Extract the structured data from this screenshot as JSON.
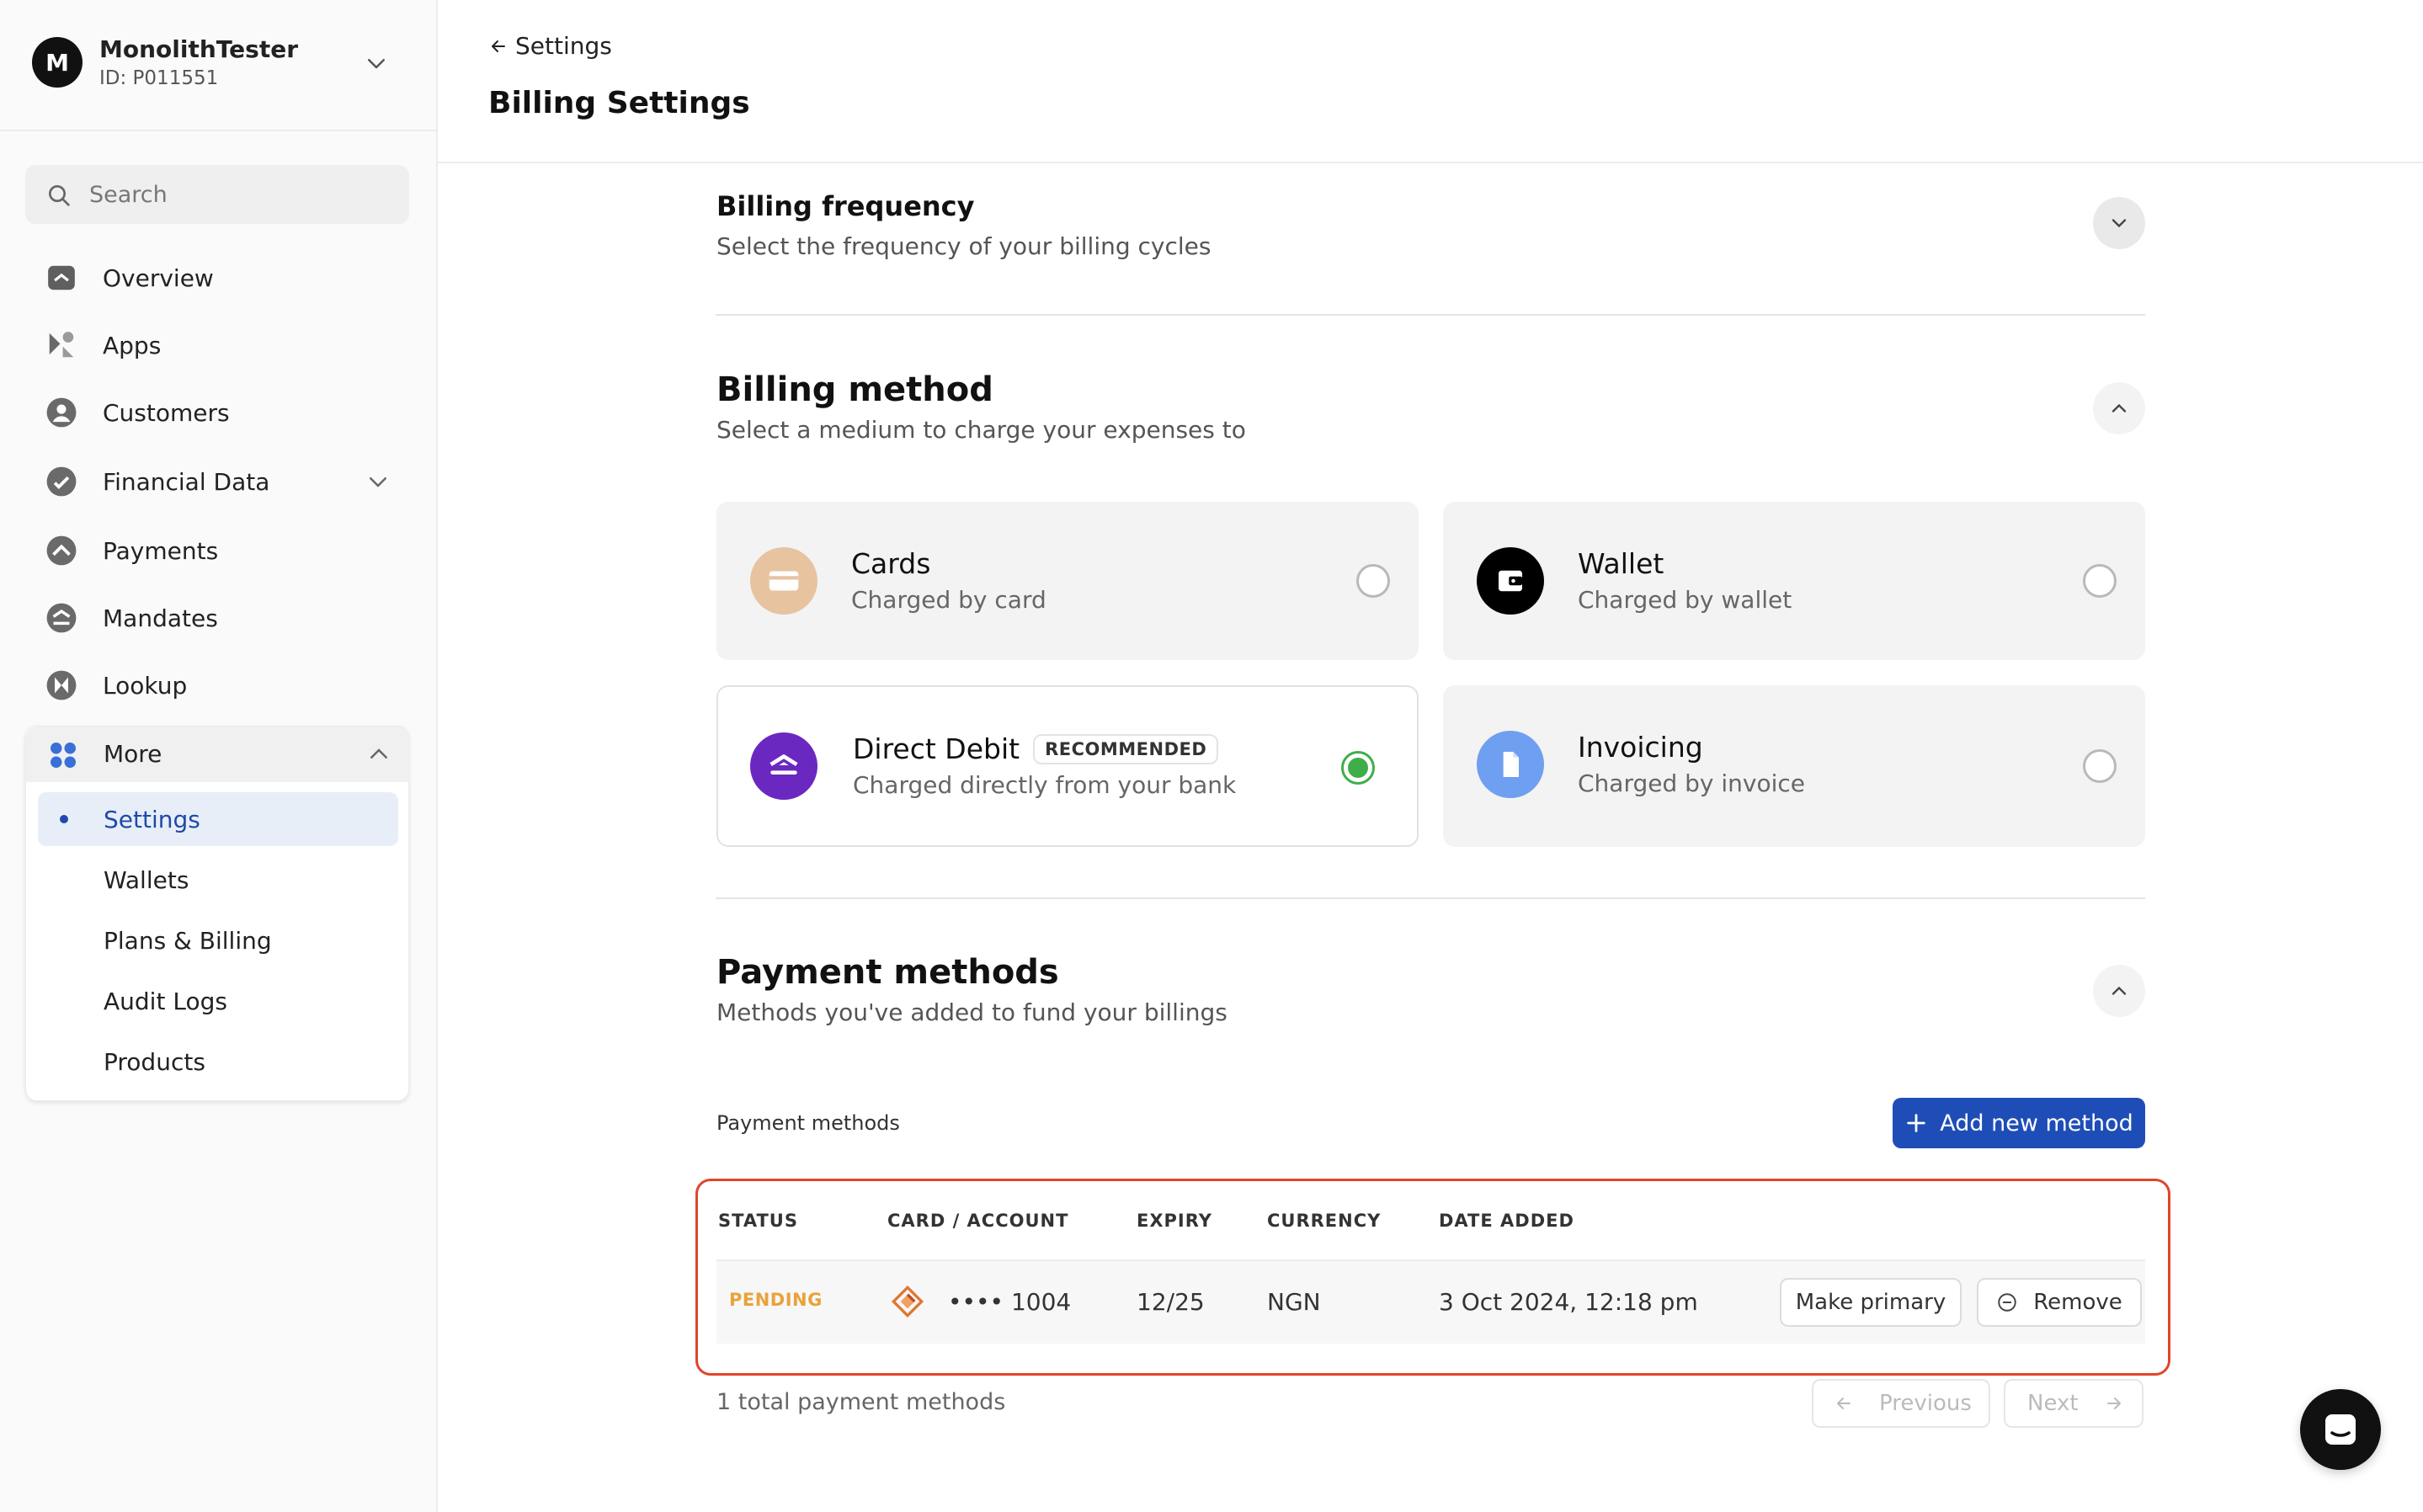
{
  "account": {
    "initial": "M",
    "name": "MonolithTester",
    "id": "ID: P011551"
  },
  "search": {
    "placeholder": "Search"
  },
  "sidebar": {
    "items": [
      {
        "label": "Overview"
      },
      {
        "label": "Apps"
      },
      {
        "label": "Customers"
      },
      {
        "label": "Financial Data"
      },
      {
        "label": "Payments"
      },
      {
        "label": "Mandates"
      },
      {
        "label": "Lookup"
      },
      {
        "label": "More"
      }
    ],
    "more_items": [
      {
        "label": "Settings",
        "active": true
      },
      {
        "label": "Wallets"
      },
      {
        "label": "Plans & Billing"
      },
      {
        "label": "Audit Logs"
      },
      {
        "label": "Products"
      }
    ]
  },
  "header": {
    "back_label": "Settings",
    "title": "Billing Settings"
  },
  "billing_frequency": {
    "title": "Billing frequency",
    "subtitle": "Select the frequency of your billing cycles"
  },
  "billing_method": {
    "title": "Billing method",
    "subtitle": "Select a medium to charge your expenses to",
    "options": [
      {
        "title": "Cards",
        "subtitle": "Charged by card",
        "icon": "card-icon",
        "color": "#e7c3a0",
        "selected": false
      },
      {
        "title": "Wallet",
        "subtitle": "Charged by wallet",
        "icon": "wallet-icon",
        "color": "#000000",
        "selected": false
      },
      {
        "title": "Direct Debit",
        "badge": "RECOMMENDED",
        "subtitle": "Charged directly from your bank",
        "icon": "bank-icon",
        "color": "#6a28c0",
        "selected": true
      },
      {
        "title": "Invoicing",
        "subtitle": "Charged by invoice",
        "icon": "document-icon",
        "color": "#6f9ff0",
        "selected": false
      }
    ]
  },
  "payment_methods": {
    "title": "Payment methods",
    "subtitle": "Methods you've added to fund your billings",
    "list_label": "Payment methods",
    "add_button": "Add new method",
    "columns": [
      "STATUS",
      "CARD / ACCOUNT",
      "EXPIRY",
      "CURRENCY",
      "DATE ADDED"
    ],
    "rows": [
      {
        "status": "PENDING",
        "card": "•••• 1004",
        "expiry": "12/25",
        "currency": "NGN",
        "date_added": "3 Oct 2024, 12:18 pm",
        "primary_button": "Make primary",
        "remove_button": "Remove"
      }
    ],
    "total": "1 total payment methods",
    "prev": "Previous",
    "next": "Next"
  },
  "colors": {
    "accent": "#1e4db7",
    "highlight_border": "#e0452a",
    "pending": "#e8a33a",
    "selected_radio": "#3fae4a"
  }
}
